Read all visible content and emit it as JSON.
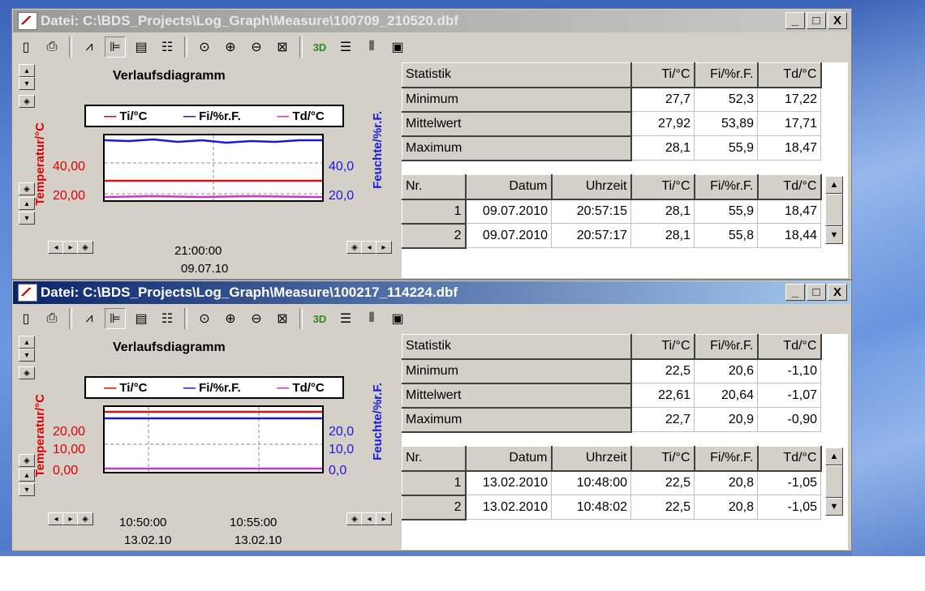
{
  "windows": [
    {
      "title": "Datei: C:\\BDS_Projects\\Log_Graph\\Measure\\100709_210520.dbf",
      "active": false,
      "chart": {
        "title": "Verlaufsdiagramm",
        "legend": [
          "Ti/°C",
          "Fi/%r.F.",
          "Td/°C"
        ],
        "y_left_title": "Temperatur/°C",
        "y_right_title": "Feuchte/%r.F.",
        "y_left_ticks": [
          "40,00",
          "20,00"
        ],
        "y_right_ticks": [
          "40,0",
          "20,0"
        ],
        "x_labels": [
          {
            "time": "21:00:00",
            "date": "09.07.10"
          }
        ]
      },
      "stats": {
        "header": [
          "Statistik",
          "Ti/°C",
          "Fi/%r.F.",
          "Td/°C"
        ],
        "rows": [
          [
            "Minimum",
            "27,7",
            "52,3",
            "17,22"
          ],
          [
            "Mittelwert",
            "27,92",
            "53,89",
            "17,71"
          ],
          [
            "Maximum",
            "28,1",
            "55,9",
            "18,47"
          ]
        ]
      },
      "data": {
        "header": [
          "Nr.",
          "Datum",
          "Uhrzeit",
          "Ti/°C",
          "Fi/%r.F.",
          "Td/°C"
        ],
        "rows": [
          [
            "1",
            "09.07.2010",
            "20:57:15",
            "28,1",
            "55,9",
            "18,47"
          ],
          [
            "2",
            "09.07.2010",
            "20:57:17",
            "28,1",
            "55,8",
            "18,44"
          ]
        ]
      }
    },
    {
      "title": "Datei: C:\\BDS_Projects\\Log_Graph\\Measure\\100217_114224.dbf",
      "active": true,
      "chart": {
        "title": "Verlaufsdiagramm",
        "legend": [
          "Ti/°C",
          "Fi/%r.F.",
          "Td/°C"
        ],
        "y_left_title": "Temperatur/°C",
        "y_right_title": "Feuchte/%r.F.",
        "y_left_ticks": [
          "20,00",
          "10,00",
          "0,00"
        ],
        "y_right_ticks": [
          "20,0",
          "10,0",
          "0,0"
        ],
        "x_labels": [
          {
            "time": "10:50:00",
            "date": "13.02.10"
          },
          {
            "time": "10:55:00",
            "date": "13.02.10"
          }
        ]
      },
      "stats": {
        "header": [
          "Statistik",
          "Ti/°C",
          "Fi/%r.F.",
          "Td/°C"
        ],
        "rows": [
          [
            "Minimum",
            "22,5",
            "20,6",
            "-1,10"
          ],
          [
            "Mittelwert",
            "22,61",
            "20,64",
            "-1,07"
          ],
          [
            "Maximum",
            "22,7",
            "20,9",
            "-0,90"
          ]
        ]
      },
      "data": {
        "header": [
          "Nr.",
          "Datum",
          "Uhrzeit",
          "Ti/°C",
          "Fi/%r.F.",
          "Td/°C"
        ],
        "rows": [
          [
            "1",
            "13.02.2010",
            "10:48:00",
            "22,5",
            "20,8",
            "-1,05"
          ],
          [
            "2",
            "13.02.2010",
            "10:48:02",
            "22,5",
            "20,8",
            "-1,05"
          ]
        ]
      }
    }
  ],
  "caption_buttons": [
    "_",
    "□",
    "X"
  ],
  "colors": {
    "ti": "#dd1111",
    "fi": "#1a1adb",
    "td": "#cc33cc"
  }
}
